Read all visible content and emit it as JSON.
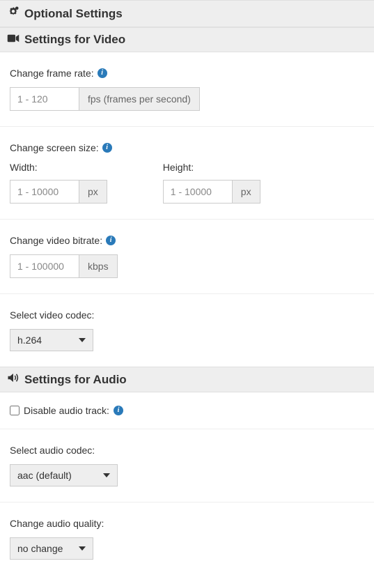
{
  "headers": {
    "optional": "Optional Settings",
    "video": "Settings for Video",
    "audio": "Settings for Audio"
  },
  "video": {
    "framerate": {
      "label": "Change frame rate:",
      "placeholder": "1 - 120",
      "unit": "fps (frames per second)"
    },
    "screensize": {
      "label": "Change screen size:",
      "width_label": "Width:",
      "height_label": "Height:",
      "width_placeholder": "1 - 10000",
      "height_placeholder": "1 - 10000",
      "unit": "px"
    },
    "bitrate": {
      "label": "Change video bitrate:",
      "placeholder": "1 - 100000",
      "unit": "kbps"
    },
    "codec": {
      "label": "Select video codec:",
      "selected": "h.264"
    }
  },
  "audio": {
    "disable": {
      "label": "Disable audio track:"
    },
    "codec": {
      "label": "Select audio codec:",
      "selected": "aac (default)"
    },
    "quality": {
      "label": "Change audio quality:",
      "selected": "no change"
    }
  }
}
